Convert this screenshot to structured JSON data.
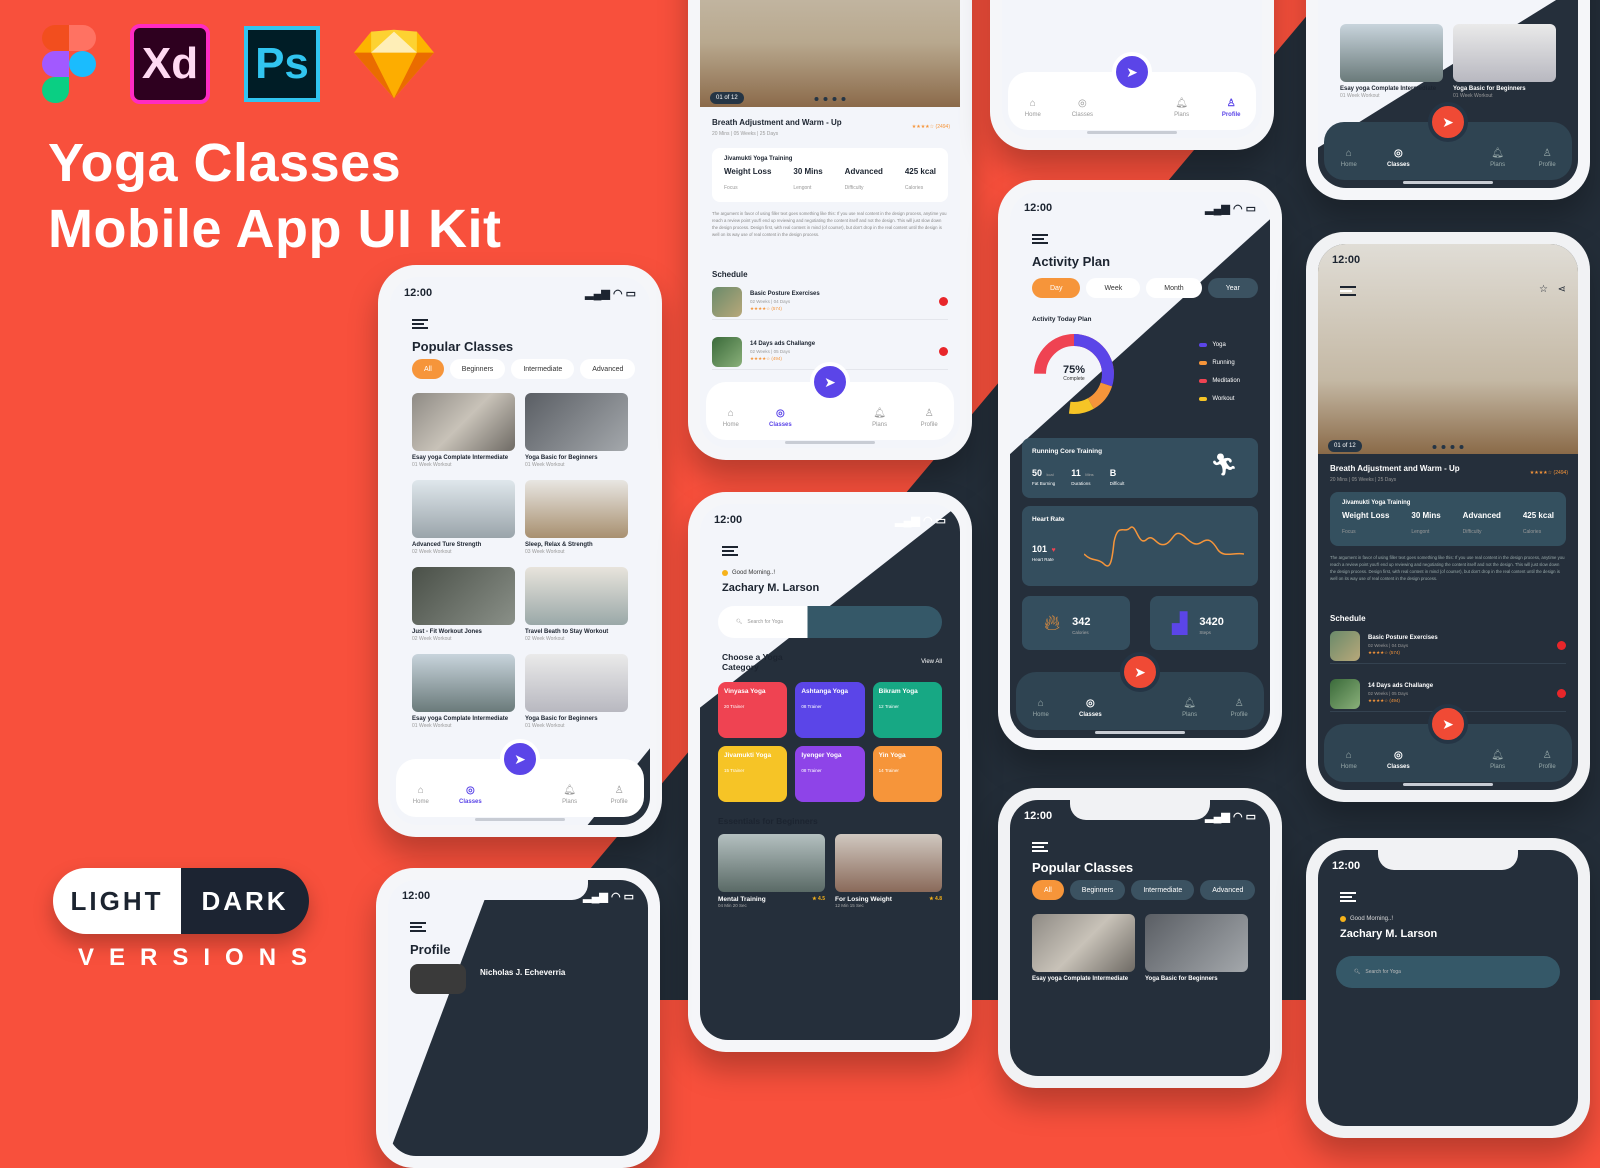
{
  "hero": {
    "tool_logos": [
      {
        "name": "figma-logo",
        "text": ""
      },
      {
        "name": "adobe-xd-logo",
        "text": "Xd"
      },
      {
        "name": "photoshop-logo",
        "text": "Ps"
      },
      {
        "name": "sketch-logo",
        "text": ""
      }
    ],
    "title_line1": "Yoga Classes",
    "title_line2": "Mobile App UI Kit",
    "toggle_light": "LIGHT",
    "toggle_dark": "DARK",
    "versions_label": "VERSIONS"
  },
  "colors": {
    "brand_red": "#f8503c",
    "dark_bg": "#232d38",
    "accent_purple": "#5b45e8",
    "accent_orange": "#f6953a",
    "panel_teal": "#344e5e"
  },
  "status": {
    "time": "12:00"
  },
  "tabs": [
    {
      "label": "Home",
      "icon": "home-icon"
    },
    {
      "label": "Classes",
      "icon": "compass-icon"
    },
    {
      "label": "Plans",
      "icon": "bell-icon"
    },
    {
      "label": "Profile",
      "icon": "user-icon"
    }
  ],
  "popular": {
    "title": "Popular Classes",
    "filters": [
      "All",
      "Beginners",
      "Intermediate",
      "Advanced"
    ],
    "classes": [
      {
        "title": "Esay yoga Complate Intermediate",
        "sub": "01 Week Workout"
      },
      {
        "title": "Yoga Basic for Beginners",
        "sub": "01 Week Workout"
      },
      {
        "title": "Advanced Ture Strength",
        "sub": "02 Week Workout"
      },
      {
        "title": "Sleep, Relax & Strength",
        "sub": "03 Week Workout"
      },
      {
        "title": "Just - Fit Workout Jones",
        "sub": "02 Week Workout"
      },
      {
        "title": "Travel Beath to Stay Workout",
        "sub": "02 Week Workout"
      },
      {
        "title": "Esay yoga Complate Intermediate",
        "sub": "01 Week Workout"
      },
      {
        "title": "Yoga Basic for Beginners",
        "sub": "01 Week Workout"
      }
    ]
  },
  "detail": {
    "counter": "01 of 12",
    "title": "Breath Adjustment and Warm - Up",
    "meta": "20 Mins  |  05 Weeks  |  25 Days",
    "rating": "★★★★☆ (2494)",
    "training": "Jivamukti Yoga Training",
    "stats": [
      {
        "value": "Weight Loss",
        "label": "Focus"
      },
      {
        "value": "30 Mins",
        "label": "Lengont"
      },
      {
        "value": "Advanced",
        "label": "Difficulty"
      },
      {
        "value": "425 kcal",
        "label": "Calories"
      }
    ],
    "description": "The argument in favor of using filler text goes something like this: If you use real content in the design process, anytime you reach a review point you'll end up reviewing and negotiating the content itself and not the design. This will just slow down the design process. Design first, with real content in mind (of course!), but don't drop in the real content until the design is well on its way use of real content in the design process.",
    "schedule_title": "Schedule",
    "schedule": [
      {
        "title": "Basic Posture Exercises",
        "meta": "02 Weeks  |  04 Days",
        "rating": "★★★★☆ (574)"
      },
      {
        "title": "14 Days ads Challange",
        "meta": "02 Weeks  |  05 Days",
        "rating": "★★★★☆ (494)"
      }
    ]
  },
  "home": {
    "greeting": "Good Morning..!",
    "user_name": "Zachary M. Larson",
    "search_placeholder": "Search for Yoga",
    "category_title": "Choose a Yoga Category",
    "view_all": "View All",
    "categories": [
      {
        "name": "Vinyasa Yoga",
        "trainers": "20 Trainer",
        "color": "#ef4352"
      },
      {
        "name": "Ashtanga Yoga",
        "trainers": "08 Trainer",
        "color": "#5b45e8"
      },
      {
        "name": "Bikram Yoga",
        "trainers": "12 Trainer",
        "color": "#17a884"
      },
      {
        "name": "Jivamukti Yoga",
        "trainers": "15 Trainer",
        "color": "#f6c426"
      },
      {
        "name": "Iyenger Yoga",
        "trainers": "08 Trainer",
        "color": "#8e44e8"
      },
      {
        "name": "Yin Yoga",
        "trainers": "14 Trainer",
        "color": "#f6953a"
      }
    ],
    "essentials_title": "Essentials for Beginners",
    "essentials": [
      {
        "title": "Mental Training",
        "rating": "4.5",
        "meta": "04 Min 20 Sec"
      },
      {
        "title": "For Losing Weight",
        "rating": "4.8",
        "meta": "12 Min 15 Sec"
      }
    ]
  },
  "activity": {
    "title": "Activity Plan",
    "periods": [
      "Day",
      "Week",
      "Month",
      "Year"
    ],
    "today_title": "Activity Today Plan",
    "complete_value": "75%",
    "complete_label": "Complete",
    "legend": [
      {
        "label": "Yoga",
        "color": "#5b45e8"
      },
      {
        "label": "Running",
        "color": "#f6953a"
      },
      {
        "label": "Meditation",
        "color": "#ef4352"
      },
      {
        "label": "Workout",
        "color": "#f6c426"
      }
    ],
    "running_title": "Running Core Training",
    "running_stats": [
      {
        "value": "50",
        "unit": "kcal",
        "label": "Fat Burning"
      },
      {
        "value": "11",
        "unit": "Mins",
        "label": "Durations"
      },
      {
        "value": "B",
        "unit": "",
        "label": "Difficult"
      }
    ],
    "heart_title": "Heart Rate",
    "heart_value": "101",
    "heart_label": "Heart Rate",
    "calories_value": "342",
    "calories_label": "Calories",
    "steps_value": "3420",
    "steps_label": "Steps"
  },
  "profile": {
    "title": "Profile",
    "name": "Nicholas J. Echeverria"
  }
}
